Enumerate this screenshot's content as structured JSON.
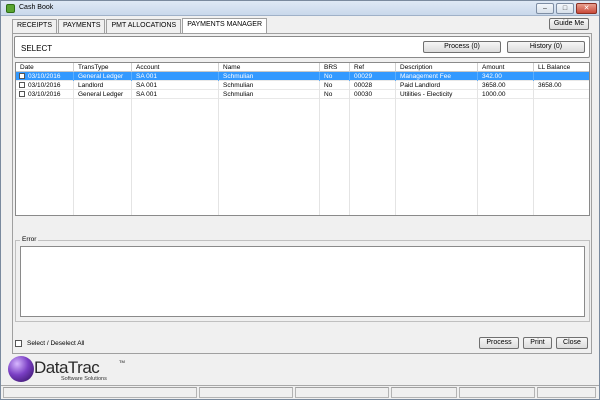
{
  "window": {
    "title": "Cash Book"
  },
  "title_buttons": {
    "minimize": "–",
    "maximize": "□",
    "close": "✕"
  },
  "tabs": [
    {
      "label": "RECEIPTS",
      "active": false
    },
    {
      "label": "PAYMENTS",
      "active": false
    },
    {
      "label": "PMT ALLOCATIONS",
      "active": false
    },
    {
      "label": "PAYMENTS MANAGER",
      "active": true
    }
  ],
  "guide_label": "Guide Me",
  "select_section": {
    "label": "SELECT",
    "process_label": "Process (0)",
    "history_label": "History (0)"
  },
  "grid": {
    "columns": [
      "Date",
      "TransType",
      "Account",
      "Name",
      "BRS",
      "Ref",
      "Description",
      "Amount",
      "LL Balance"
    ],
    "rows": [
      {
        "selected": true,
        "checked": false,
        "cells": [
          "03/10/2016",
          "General Ledger",
          "SA 001",
          "Schmulian",
          "No",
          "00029",
          "Management Fee",
          "342.00",
          ""
        ]
      },
      {
        "selected": false,
        "checked": false,
        "cells": [
          "03/10/2016",
          "Landlord",
          "SA 001",
          "Schmulian",
          "No",
          "00028",
          "Paid Landlord",
          "3658.00",
          "3658.00"
        ]
      },
      {
        "selected": false,
        "checked": false,
        "cells": [
          "03/10/2016",
          "General Ledger",
          "SA 001",
          "Schmulian",
          "No",
          "00030",
          "Utilities - Electicity",
          "1000.00",
          ""
        ]
      }
    ]
  },
  "error_section": {
    "label": "Error",
    "text": ""
  },
  "select_all_label": "Select / Deselect All",
  "footer_buttons": {
    "process": "Process",
    "print": "Print",
    "close": "Close"
  },
  "logo": {
    "name": "DataTrac",
    "trademark": "TM",
    "tagline": "Software Solutions"
  },
  "colors": {
    "selection": "#3399ff",
    "titlebar": "#c9d8eb"
  }
}
